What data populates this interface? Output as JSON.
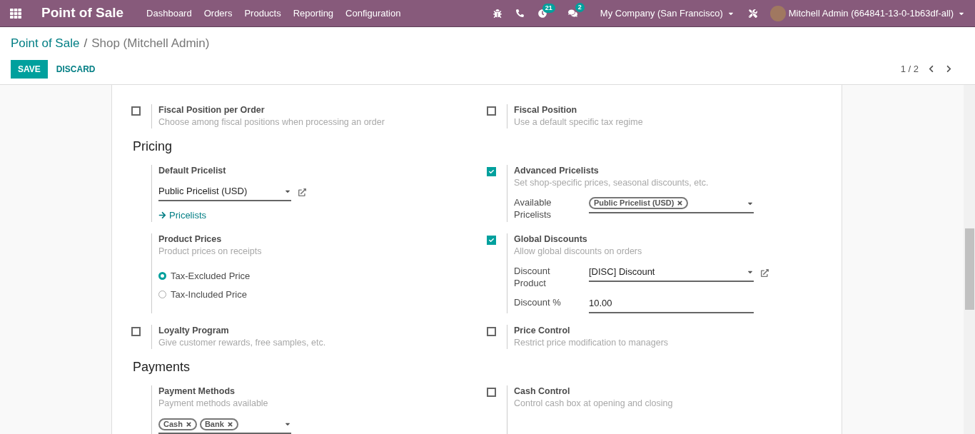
{
  "navbar": {
    "app": "Point of Sale",
    "menu": [
      "Dashboard",
      "Orders",
      "Products",
      "Reporting",
      "Configuration"
    ],
    "activity_count": "21",
    "message_count": "2",
    "company": "My Company (San Francisco)",
    "user": "Mitchell Admin (664841-13-0-1b63df-all)"
  },
  "breadcrumb": [
    "Point of Sale",
    "/",
    "Shop (Mitchell Admin)"
  ],
  "buttons": {
    "save": "SAVE",
    "discard": "DISCARD"
  },
  "pager": "1 / 2",
  "sections": [
    {
      "settings": [
        {
          "kind": "checkbox",
          "checked": false,
          "title": "Fiscal Position per Order",
          "description": "Choose among fiscal positions when processing an order"
        },
        {
          "kind": "checkbox",
          "checked": false,
          "title": "Fiscal Position",
          "description": "Use a default specific tax regime"
        }
      ]
    },
    {
      "title": "Pricing",
      "settings": [
        {
          "kind": "plain",
          "title": "Default Pricelist",
          "controls": [
            {
              "kind": "field",
              "value": "Public Pricelist (USD)",
              "dropdown": true,
              "external": true
            },
            {
              "kind": "link",
              "label": "Pricelists"
            }
          ]
        },
        {
          "kind": "checkbox",
          "checked": true,
          "title": "Advanced Pricelists",
          "description": "Set shop-specific prices, seasonal discounts, etc.",
          "controls": [
            {
              "kind": "field",
              "label": "Available Pricelists",
              "tags": [
                "Public Pricelist (USD)"
              ],
              "dropdown": true,
              "external": false
            }
          ]
        },
        {
          "kind": "plain",
          "title": "Product Prices",
          "description": "Product prices on receipts",
          "controls": [
            {
              "kind": "radio",
              "options": [
                {
                  "label": "Tax-Excluded Price",
                  "selected": true
                },
                {
                  "label": "Tax-Included Price",
                  "selected": false
                }
              ]
            }
          ]
        },
        {
          "kind": "checkbox",
          "checked": true,
          "title": "Global Discounts",
          "description": "Allow global discounts on orders",
          "controls": [
            {
              "kind": "field",
              "label": "Discount Product",
              "value": "[DISC] Discount",
              "dropdown": true,
              "external": true
            },
            {
              "kind": "field",
              "label": "Discount %",
              "value": "10.00",
              "dropdown": false,
              "external": false
            }
          ]
        },
        {
          "kind": "checkbox",
          "checked": false,
          "title": "Loyalty Program",
          "description": "Give customer rewards, free samples, etc."
        },
        {
          "kind": "checkbox",
          "checked": false,
          "title": "Price Control",
          "description": "Restrict price modification to managers"
        }
      ]
    },
    {
      "title": "Payments",
      "settings": [
        {
          "kind": "plain",
          "title": "Payment Methods",
          "description": "Payment methods available",
          "controls": [
            {
              "kind": "field",
              "tags": [
                "Cash",
                "Bank"
              ],
              "dropdown": true,
              "external": false
            }
          ]
        },
        {
          "kind": "checkbox",
          "checked": false,
          "title": "Cash Control",
          "description": "Control cash box at opening and closing"
        }
      ]
    }
  ]
}
